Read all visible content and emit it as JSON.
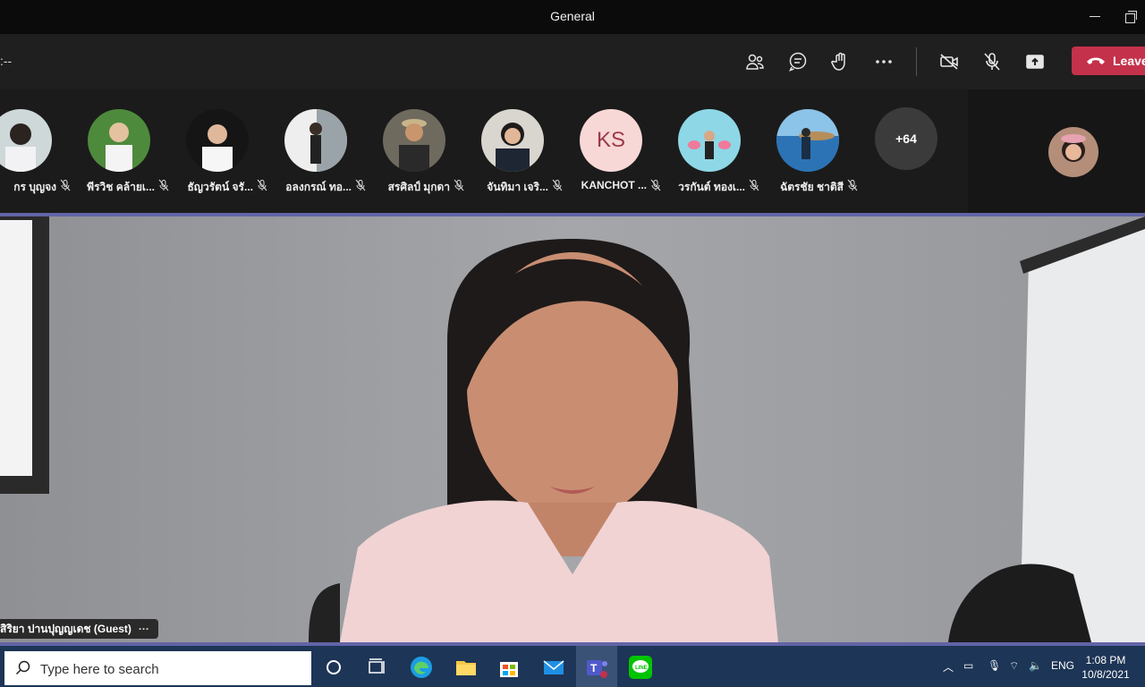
{
  "window": {
    "title": "General"
  },
  "toolbar": {
    "timer": ":--",
    "leave_label": "Leave",
    "icons": [
      "people-icon",
      "chat-icon",
      "raise-hand-icon",
      "more-icon",
      "camera-off-icon",
      "mic-off-icon",
      "share-screen-icon"
    ]
  },
  "participants": [
    {
      "name": "กร บุญจง"
    },
    {
      "name": "พีรวิช คล้ายเ..."
    },
    {
      "name": "ธัญวรัตน์ จรั..."
    },
    {
      "name": "อลงกรณ์ ทอ..."
    },
    {
      "name": "สรศิลป์ มุกดา"
    },
    {
      "name": "จันทิมา เจริ..."
    },
    {
      "name": "KANCHOT ...",
      "initials": "KS"
    },
    {
      "name": "วรกันต์ ทองเ..."
    },
    {
      "name": "ฉัตรชัย ชาติสี"
    }
  ],
  "more_participants": "+64",
  "speaker": {
    "name": "สิริยา ปานปุญญเดช (Guest)",
    "menu": "···"
  },
  "taskbar": {
    "search_placeholder": "Type here to search",
    "language": "ENG",
    "time": "1:08 PM",
    "date": "10/8/2021"
  },
  "colors": {
    "accent": "#6264a7",
    "leave": "#c4314b",
    "taskbar": "#1d3556",
    "ks_avatar_bg": "#f8d8d6",
    "ks_avatar_fg": "#9b3a4a"
  }
}
